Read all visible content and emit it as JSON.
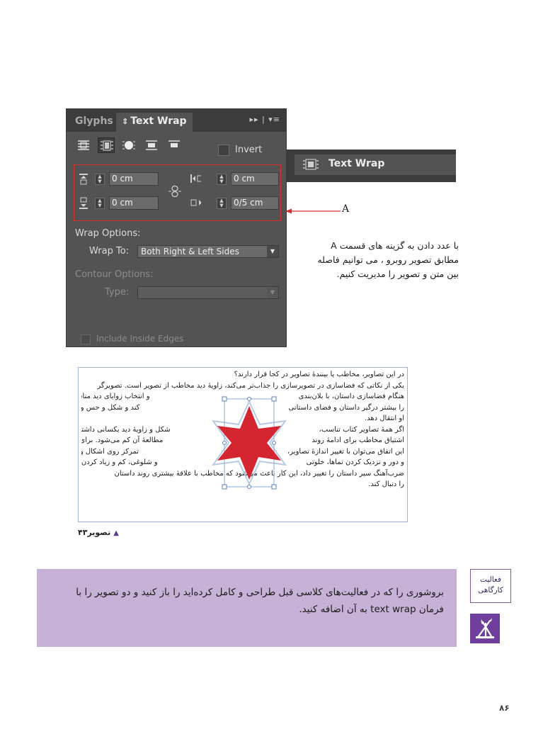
{
  "panel": {
    "tab_glyphs": "Glyphs",
    "tab_textwrap": "Text Wrap",
    "tab_textwrap_icon": "updown-arrows-icon",
    "controls": "▸▸ | ▾≡",
    "invert_label": "Invert",
    "offsets": {
      "top": "0 cm",
      "bottom": "0 cm",
      "left": "0 cm",
      "right": "0/5 cm"
    },
    "wrap_options_label": "Wrap Options:",
    "wrap_to_label": "Wrap To:",
    "wrap_to_value": "Both Right & Left Sides",
    "contour_options_label": "Contour Options:",
    "type_label": "Type:",
    "type_value": "",
    "include_inside_edges_label": "Include Inside Edges",
    "accent_color": "#d82d2d"
  },
  "collapsed_panel": {
    "title": "Text Wrap"
  },
  "callout": {
    "label": "A"
  },
  "explanation": {
    "lines": [
      "با عدد دادن به گزینه های قسمت A",
      "مطابق تصویر روبرو ، می توانیم فاصله",
      "بین متن و تصویر را مدیریت کنیم."
    ]
  },
  "sample": {
    "lines": [
      "در این تصاویر، مخاطب یا بینندهٔ تصاویر در کجا قرار دارند؟",
      "یکی از نکاتی که فضاسازی در تصویرسازی را جذاب‌تر می‌کند، زاویهٔ دید مخاطب از تصویر است. تصویرگر",
      "هنگام فضاسازی داستان، با بلان‌بندی",
      "و انتخاب زوایای دید مناسب می‌تواند مخاطب",
      "را بیشتر درگیر داستان و فضای داستانی",
      "کند و شکل و حس و حال و هوای مکان را به",
      "او انتقال دهد.",
      "اگر همهٔ تصاویر کتاب تناسب،",
      "شکل و زاویهٔ دید یکسانی داشته باشند،",
      "اشتیاق مخاطب برای ادامهٔ روند",
      "مطالعهٔ آن کم می‌شود. برای جلوگیری از",
      "این اتفاق می‌توان با تغییر اندازهٔ تصاویر،",
      "تمرکز روی اشکال و شخصیت‌ها، چرخش",
      "و دور و نزدیک کردن نماها، خلوتی",
      "و شلوغی، کم و زیاد کردن محل نوشتار، میزان",
      "ضرب‌آهنگ سیر داستان را تغییر داد، این کار باعث می‌شود که مخاطب با علاقهٔ بیشتری روند داستان",
      "را دنبال کند."
    ],
    "star_color": "#d42630",
    "caption": "تصویر۴۳"
  },
  "activity": {
    "tag": [
      "فعالیت",
      "کارگاهی"
    ],
    "icon": "brush-pencil-icon",
    "lines": [
      "بروشوری را که در فعالیت‌های کلاسی قبل طراحی و کامل کرده‌اید را باز کنید و دو تصویر را با",
      "فرمان text wrap به آن اضافه کنید."
    ],
    "color": "#c6b2d6"
  },
  "page_number": "۸۶"
}
